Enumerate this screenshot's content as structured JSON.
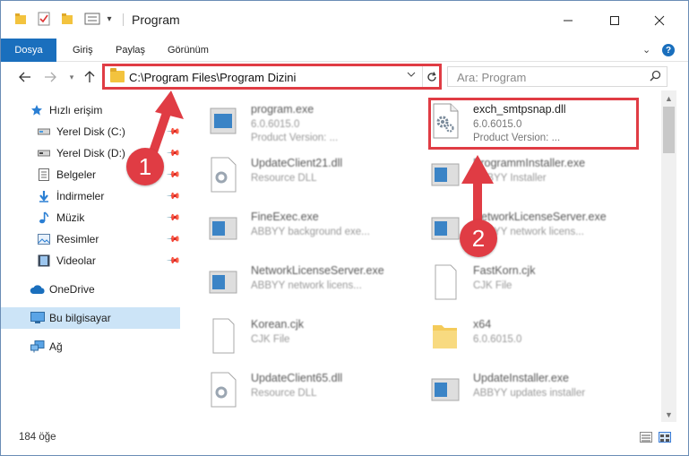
{
  "window": {
    "title": "Program",
    "quick_access_dropdown": "▾"
  },
  "ribbon": {
    "tabs": [
      "Dosya",
      "Giriş",
      "Paylaş",
      "Görünüm"
    ],
    "expand_label": "⌄",
    "help_label": "?"
  },
  "address": {
    "path": "C:\\Program Files\\Program Dizini",
    "search_placeholder": "Ara: Program"
  },
  "sidebar": {
    "items": [
      {
        "label": "Hızlı erişim",
        "icon": "star-icon",
        "pinned": false
      },
      {
        "label": "Yerel Disk (C:)",
        "icon": "drive-icon",
        "pinned": true
      },
      {
        "label": "Yerel Disk (D:)",
        "icon": "drive-icon",
        "pinned": true
      },
      {
        "label": "Belgeler",
        "icon": "documents-icon",
        "pinned": true
      },
      {
        "label": "İndirmeler",
        "icon": "download-icon",
        "pinned": true
      },
      {
        "label": "Müzik",
        "icon": "music-icon",
        "pinned": true
      },
      {
        "label": "Resimler",
        "icon": "pictures-icon",
        "pinned": true
      },
      {
        "label": "Videolar",
        "icon": "videos-icon",
        "pinned": true
      },
      {
        "label": "OneDrive",
        "icon": "cloud-icon",
        "pinned": false
      },
      {
        "label": "Bu bilgisayar",
        "icon": "computer-icon",
        "pinned": false,
        "selected": true
      },
      {
        "label": "Ağ",
        "icon": "network-icon",
        "pinned": false
      }
    ]
  },
  "files": [
    {
      "name": "program.exe",
      "sub": "6.0.6015.0",
      "sub2": "Product Version: ...",
      "icon": "exe-icon",
      "blurred": true
    },
    {
      "name": "exch_smtpsnap.dll",
      "sub": "6.0.6015.0",
      "sub2": "Product Version:     ...",
      "icon": "dll-icon",
      "blurred": false,
      "highlighted": true
    },
    {
      "name": "UpdateClient21.dll",
      "sub": "Resource DLL",
      "icon": "dll-icon",
      "blurred": true
    },
    {
      "name": "ProgrammInstaller.exe",
      "sub": "ABBYY Installer",
      "icon": "exe-icon",
      "blurred": true
    },
    {
      "name": "FineExec.exe",
      "sub": "ABBYY background exe...",
      "icon": "exe-icon",
      "blurred": true
    },
    {
      "name": "NetworkLicenseServer.exe",
      "sub": "ABBYY network licens...",
      "icon": "exe-icon",
      "blurred": true
    },
    {
      "name": "NetworkLicenseServer.exe",
      "sub": "ABBYY network licens...",
      "icon": "exe-icon",
      "blurred": true
    },
    {
      "name": "FastKorn.cjk",
      "sub": "CJK File",
      "icon": "file-icon",
      "blurred": true
    },
    {
      "name": "Korean.cjk",
      "sub": "CJK File",
      "icon": "file-icon",
      "blurred": true
    },
    {
      "name": "x64",
      "sub": "6.0.6015.0",
      "icon": "folder-icon",
      "blurred": true
    },
    {
      "name": "UpdateClient65.dll",
      "sub": "Resource DLL",
      "icon": "dll-icon",
      "blurred": true
    },
    {
      "name": "UpdateInstaller.exe",
      "sub": "ABBYY updates installer",
      "icon": "exe-icon",
      "blurred": true
    }
  ],
  "status": {
    "item_count": "184 öğe"
  },
  "annotations": {
    "step1": "1",
    "step2": "2",
    "color": "#e03c44"
  }
}
